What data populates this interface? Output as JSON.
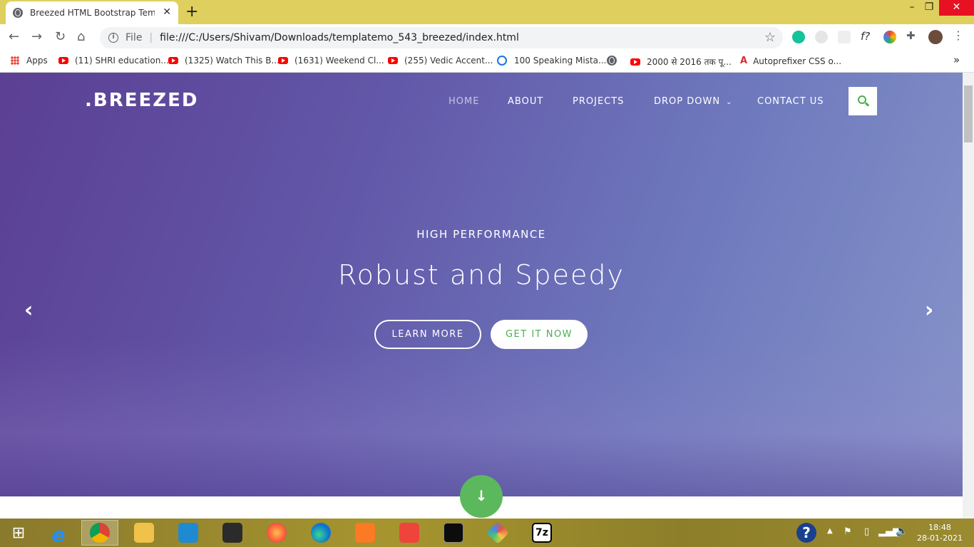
{
  "browser": {
    "tab_title": "Breezed HTML Bootstrap Templa",
    "tab_close": "✕",
    "new_tab": "+",
    "window": {
      "minimize": "–",
      "maximize": "❐",
      "close": "✕"
    },
    "address": {
      "scheme_label": "File",
      "url": "file:///C:/Users/Shivam/Downloads/templatemo_543_breezed/index.html"
    },
    "bookmarks": [
      {
        "label": "Apps"
      },
      {
        "label": "(11) SHRI education..."
      },
      {
        "label": "(1325) Watch This B..."
      },
      {
        "label": "(1631) Weekend Cl..."
      },
      {
        "label": "(255) Vedic Accent..."
      },
      {
        "label": "100 Speaking Mista..."
      },
      {
        "label": "2000 से 2016 तक पू..."
      },
      {
        "label": "Autoprefixer CSS o..."
      }
    ],
    "more_bookmarks": "»"
  },
  "site": {
    "logo": ".BREEZED",
    "nav": [
      "HOME",
      "ABOUT",
      "PROJECTS",
      "DROP DOWN",
      "CONTACT US"
    ],
    "hero": {
      "kicker": "HIGH PERFORMANCE",
      "headline": "Robust and Speedy",
      "btn_learn": "LEARN MORE",
      "btn_get": "GET IT NOW"
    },
    "prev_arrow": "‹",
    "next_arrow": "›",
    "scroll_down": "↓"
  },
  "taskbar": {
    "time": "18:48",
    "date": "28-01-2021"
  },
  "colors": {
    "accent": "#5cb85c",
    "hero_start": "#5b3f93",
    "hero_end": "#8694c9"
  }
}
